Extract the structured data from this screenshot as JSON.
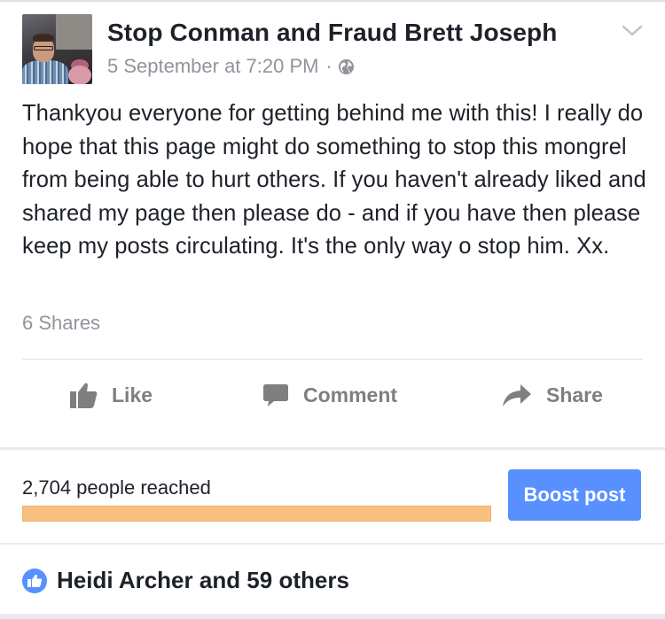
{
  "post": {
    "page_name": "Stop Conman and Fraud Brett Joseph",
    "date": "5 September at 7:20 PM",
    "separator": "·",
    "privacy_icon": "globe-icon",
    "menu_icon": "chevron-down-icon",
    "avatar_icon": "profile-photo",
    "text": "Thankyou everyone for getting behind me with this! I really do hope that this page might do something to stop this mongrel from being able to hurt others. If you haven't already liked and shared my page then please do - and if you have then please keep my posts circulating. It's the only way o stop him. Xx.",
    "shares": "6 Shares"
  },
  "actions": {
    "like": {
      "label": "Like",
      "icon": "thumbs-up-icon"
    },
    "comment": {
      "label": "Comment",
      "icon": "comment-bubble-icon"
    },
    "share": {
      "label": "Share",
      "icon": "share-arrow-icon"
    }
  },
  "insights": {
    "reached_text": "2,704 people reached",
    "boost_label": "Boost post",
    "reach_progress_percent": 100,
    "colors": {
      "boost_button": "#5890ff",
      "progress_fill": "#f9c180"
    }
  },
  "reactions": {
    "icon": "like-badge-icon",
    "text": "Heidi Archer and 59 others",
    "badge_color": "#5890ff"
  }
}
